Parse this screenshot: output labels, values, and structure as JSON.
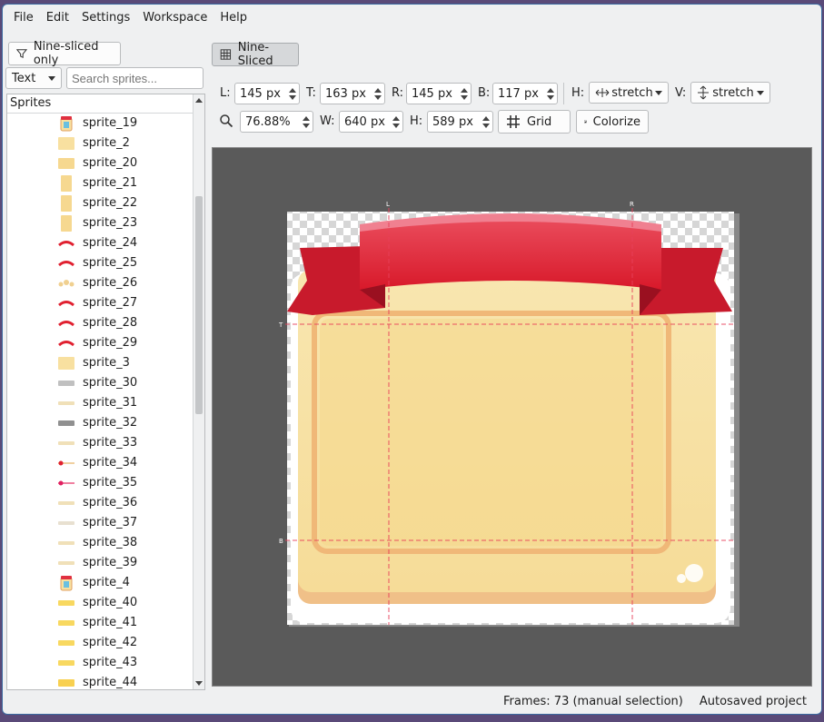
{
  "menu": [
    "File",
    "Edit",
    "Settings",
    "Workspace",
    "Help"
  ],
  "filter_button": "Nine-sliced only",
  "filter_mode": "Text",
  "search_placeholder": "Search sprites...",
  "list_header": "Sprites",
  "sprites": [
    {
      "name": "sprite_19",
      "icon": "jar"
    },
    {
      "name": "sprite_2",
      "icon": "panel"
    },
    {
      "name": "sprite_20",
      "icon": "panel-wide"
    },
    {
      "name": "sprite_21",
      "icon": "panel-tall"
    },
    {
      "name": "sprite_22",
      "icon": "panel-tall"
    },
    {
      "name": "sprite_23",
      "icon": "panel-tall"
    },
    {
      "name": "sprite_24",
      "icon": "ribbon"
    },
    {
      "name": "sprite_25",
      "icon": "ribbon"
    },
    {
      "name": "sprite_26",
      "icon": "stars"
    },
    {
      "name": "sprite_27",
      "icon": "ribbon"
    },
    {
      "name": "sprite_28",
      "icon": "ribbon"
    },
    {
      "name": "sprite_29",
      "icon": "ribbon"
    },
    {
      "name": "sprite_3",
      "icon": "panel"
    },
    {
      "name": "sprite_30",
      "icon": "bar-gray"
    },
    {
      "name": "sprite_31",
      "icon": "bar-cream"
    },
    {
      "name": "sprite_32",
      "icon": "bar-dark"
    },
    {
      "name": "sprite_33",
      "icon": "bar-cream"
    },
    {
      "name": "sprite_34",
      "icon": "slider-red"
    },
    {
      "name": "sprite_35",
      "icon": "slider-pink"
    },
    {
      "name": "sprite_36",
      "icon": "bar-cream"
    },
    {
      "name": "sprite_37",
      "icon": "bar-light"
    },
    {
      "name": "sprite_38",
      "icon": "bar-cream"
    },
    {
      "name": "sprite_39",
      "icon": "bar-cream"
    },
    {
      "name": "sprite_4",
      "icon": "jar"
    },
    {
      "name": "sprite_40",
      "icon": "bar-yellow"
    },
    {
      "name": "sprite_41",
      "icon": "bar-yellow"
    },
    {
      "name": "sprite_42",
      "icon": "bar-yellow"
    },
    {
      "name": "sprite_43",
      "icon": "bar-yellow"
    },
    {
      "name": "sprite_44",
      "icon": "bar-yellow-thick"
    }
  ],
  "toolbar": {
    "nine_sliced_label": "Nine-Sliced",
    "l_label": "L:",
    "l_value": "145 px",
    "t_label": "T:",
    "t_value": "163 px",
    "r_label": "R:",
    "r_value": "145 px",
    "b_label": "B:",
    "b_value": "117 px",
    "h_label": "H:",
    "h_mode": "stretch",
    "v_label": "V:",
    "v_mode": "stretch",
    "zoom_value": "76.88%",
    "w_label": "W:",
    "w_value": "640 px",
    "h2_label": "H:",
    "h2_value": "589 px",
    "grid_label": "Grid",
    "colorize_label": "Colorize"
  },
  "canvas": {
    "guide_l": "L",
    "guide_r": "R",
    "guide_t": "T",
    "guide_b": "B"
  },
  "status": {
    "frames": "Frames: 73 (manual selection)",
    "autosave": "Autosaved project"
  },
  "colors": {
    "accent": "#3a6aa0",
    "canvas_bg": "#5a5a5a",
    "guide": "#e8405a"
  }
}
